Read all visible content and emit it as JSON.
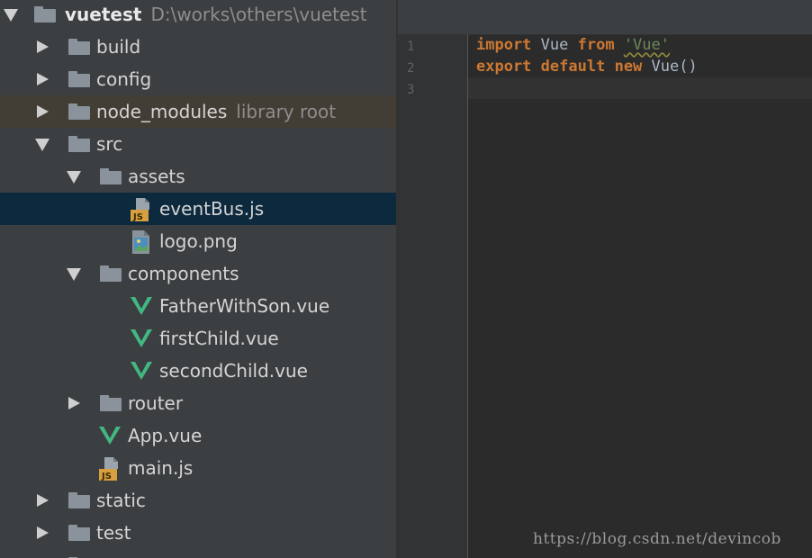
{
  "tree": {
    "root": {
      "name": "vuetest",
      "path": "D:\\works\\others\\vuetest"
    },
    "items": [
      {
        "label": "build"
      },
      {
        "label": "config"
      },
      {
        "label": "node_modules",
        "sublabel": "library root"
      },
      {
        "label": "src"
      },
      {
        "label": "assets"
      },
      {
        "label": "eventBus.js"
      },
      {
        "label": "logo.png"
      },
      {
        "label": "components"
      },
      {
        "label": "FatherWithSon.vue"
      },
      {
        "label": "firstChild.vue"
      },
      {
        "label": "secondChild.vue"
      },
      {
        "label": "router"
      },
      {
        "label": "App.vue"
      },
      {
        "label": "main.js"
      },
      {
        "label": "static"
      },
      {
        "label": "test"
      }
    ],
    "icons": {
      "folder": "folder-icon",
      "js": "js-file-icon",
      "png": "image-file-icon",
      "vue": "vue-file-icon"
    }
  },
  "editor": {
    "line_numbers": [
      "1",
      "2",
      "3"
    ],
    "line1": {
      "k1": "import",
      "t1": " Vue ",
      "k2": "from",
      "t2": " ",
      "s": "'Vue'"
    },
    "line2": {
      "k1": "export",
      "t1": " ",
      "k2": "default",
      "t2": " ",
      "k3": "new",
      "t3": " Vue()"
    }
  },
  "watermark": "https://blog.csdn.net/devincob",
  "colors": {
    "tree_bg": "#3c3f41",
    "selection": "#0d293e",
    "library_root_highlight": "#433e35",
    "keyword": "#cc7832",
    "string": "#6a8759",
    "text": "#a9b7c6",
    "vue_green": "#41b883",
    "js_badge": "#d6a041"
  }
}
